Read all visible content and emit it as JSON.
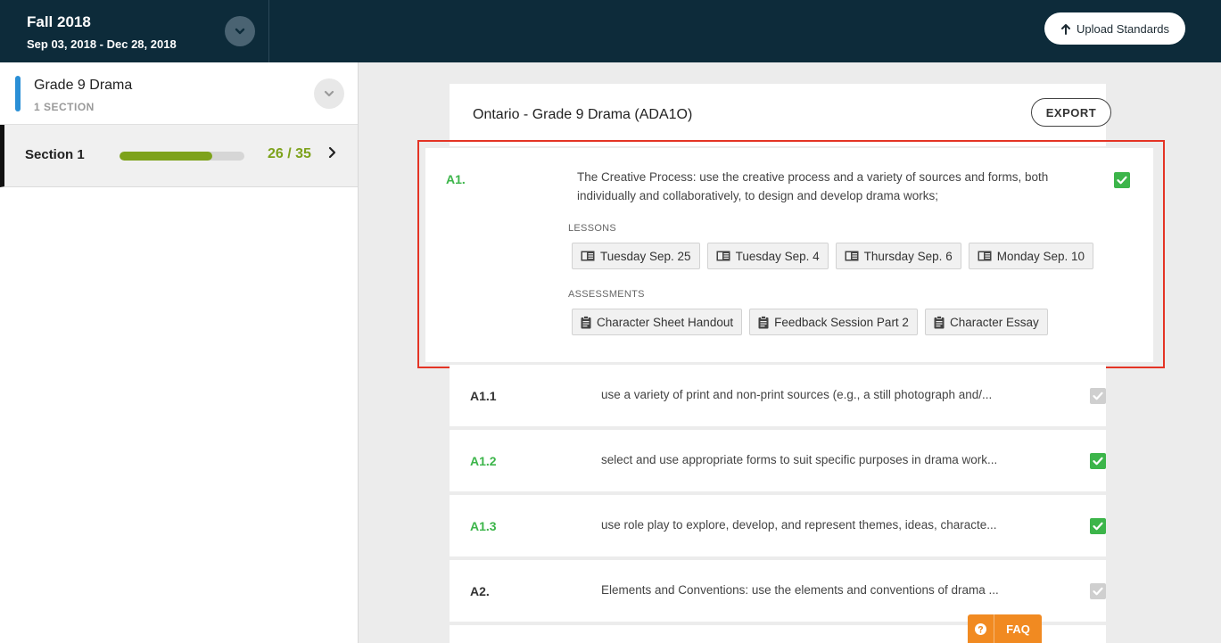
{
  "header": {
    "term_name": "Fall 2018",
    "term_dates": "Sep 03, 2018 - Dec 28, 2018",
    "upload_label": "Upload Standards"
  },
  "sidebar": {
    "course_name": "Grade 9 Drama",
    "course_sub": "1  SECTION",
    "course_accent": "#2a8fd6",
    "section": {
      "name": "Section 1",
      "progress_label": "26 / 35",
      "progress_fraction": 0.743
    }
  },
  "main": {
    "doc_title": "Ontario - Grade 9 Drama (ADA1O)",
    "export_label": "EXPORT",
    "expanded": {
      "code": "A1.",
      "text": "The Creative Process: use the creative process and a variety of sources and forms, both individually and collaboratively, to design and develop drama works;",
      "checked": true,
      "lessons_label": "LESSONS",
      "lessons": [
        "Tuesday Sep. 25",
        "Tuesday Sep. 4",
        "Thursday Sep. 6",
        "Monday Sep. 10"
      ],
      "assessments_label": "ASSESSMENTS",
      "assessments": [
        "Character Sheet Handout",
        "Feedback Session Part 2",
        "Character Essay"
      ]
    },
    "standards": [
      {
        "code": "A1.1",
        "text": "use a variety of print and non-print sources (e.g., a still photograph and/...",
        "checked": false
      },
      {
        "code": "A1.2",
        "text": "select and use appropriate forms to suit specific purposes in drama work...",
        "checked": true
      },
      {
        "code": "A1.3",
        "text": "use role play to explore, develop, and represent themes, ideas, characte...",
        "checked": true
      },
      {
        "code": "A2.",
        "text": "Elements and Conventions: use the elements and conventions of drama ...",
        "checked": false
      }
    ]
  },
  "faq_label": "FAQ",
  "colors": {
    "header_bg": "#0d2b3a",
    "progress": "#7da21b",
    "checked": "#3cb54a",
    "unchecked": "#cfcfcf",
    "highlight": "#e43425",
    "faq": "#f18a21"
  }
}
